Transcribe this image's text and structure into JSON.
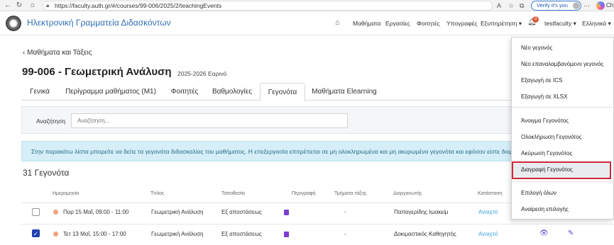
{
  "browser": {
    "url": "https://faculty.auth.gr/#/courses/99-006/2025/2/teachingEvents",
    "verify_label": "Verify it's you",
    "profile_text": "Ch"
  },
  "header": {
    "app_title": "Ηλεκτρονική Γραμματεία Διδασκόντων",
    "nav": [
      "Μαθήματα",
      "Εργασίες",
      "Φοιτητές",
      "Υπογραφές",
      "Εξυπηρέτηση"
    ],
    "notification_count": "3",
    "user": "testfaculty",
    "language": "Ελληνικά"
  },
  "page": {
    "back_link": "Μαθήματα και Τάξεις",
    "course_title": "99-006 - Γεωμετρική Ανάλυση",
    "course_year": "2025-2026 Εαρινό",
    "tabs": [
      "Γενικά",
      "Περίγραμμα μαθήματος (Μ1)",
      "Φοιτητές",
      "Βαθμολογίες",
      "Γεγονότα",
      "Μαθήματα Elearning"
    ],
    "active_tab": "Γεγονότα",
    "search_label": "Αναζήτηση",
    "search_placeholder": "Αναζήτηση...",
    "info_text": "Στην παρακάτω λίστα μπορείτε να δείτε τα γεγονότα διδασκαλίας του μαθήματος. Η επεξεργασία επιτρέπεται σε μη ολοκληρωμένα και μη ακυρωμένα γεγονότα και εφόσον είστε διοργαν",
    "events_count": "31 Γεγονότα"
  },
  "table": {
    "headers": [
      "Ημερομηνία",
      "Τίτλος",
      "Τοποθεσία",
      "Περιγραφή",
      "Τμήματα τάξης",
      "Διοργανωτής",
      "Κατάσταση"
    ],
    "rows": [
      {
        "checked": false,
        "date": "Παρ 15 Μαΐ, 09:00 - 11:00",
        "title": "Γεωμετρική Ανάλυση",
        "location": "Εξ αποστάσεως",
        "sections": "-",
        "organizer": "Παπαγερίδης Ιωακείμ",
        "status": "Ανοιχτό"
      },
      {
        "checked": true,
        "date": "Τετ 13 Μαΐ, 15:00 - 17:00",
        "title": "Γεωμετρική Ανάλυση",
        "location": "Εξ αποστάσεως",
        "sections": "-",
        "organizer": "Δοκιμαστικός Καθηγητής",
        "status": "Ανοιχτό"
      }
    ]
  },
  "dropdown": {
    "items": [
      "Νέο γεγονός",
      "Νέο επαναλαμβανόμενο γεγονός",
      "Εξαγωγή σε ICS",
      "Εξαγωγή σε XLSX",
      "Άνοιγμα Γεγονότος",
      "Ολοκλήρωση Γεγονότος",
      "Ακύρωση Γεγονότος",
      "Διαγραφή Γεγονότος",
      "Επιλογή όλων",
      "Αναίρεση επιλογής"
    ],
    "highlighted": "Διαγραφή Γεγονότος"
  },
  "colors": {
    "accent": "#2f6db2",
    "highlight_border": "#d0283a",
    "info_bg": "#d5eef7",
    "status": "#3a9fd8"
  }
}
